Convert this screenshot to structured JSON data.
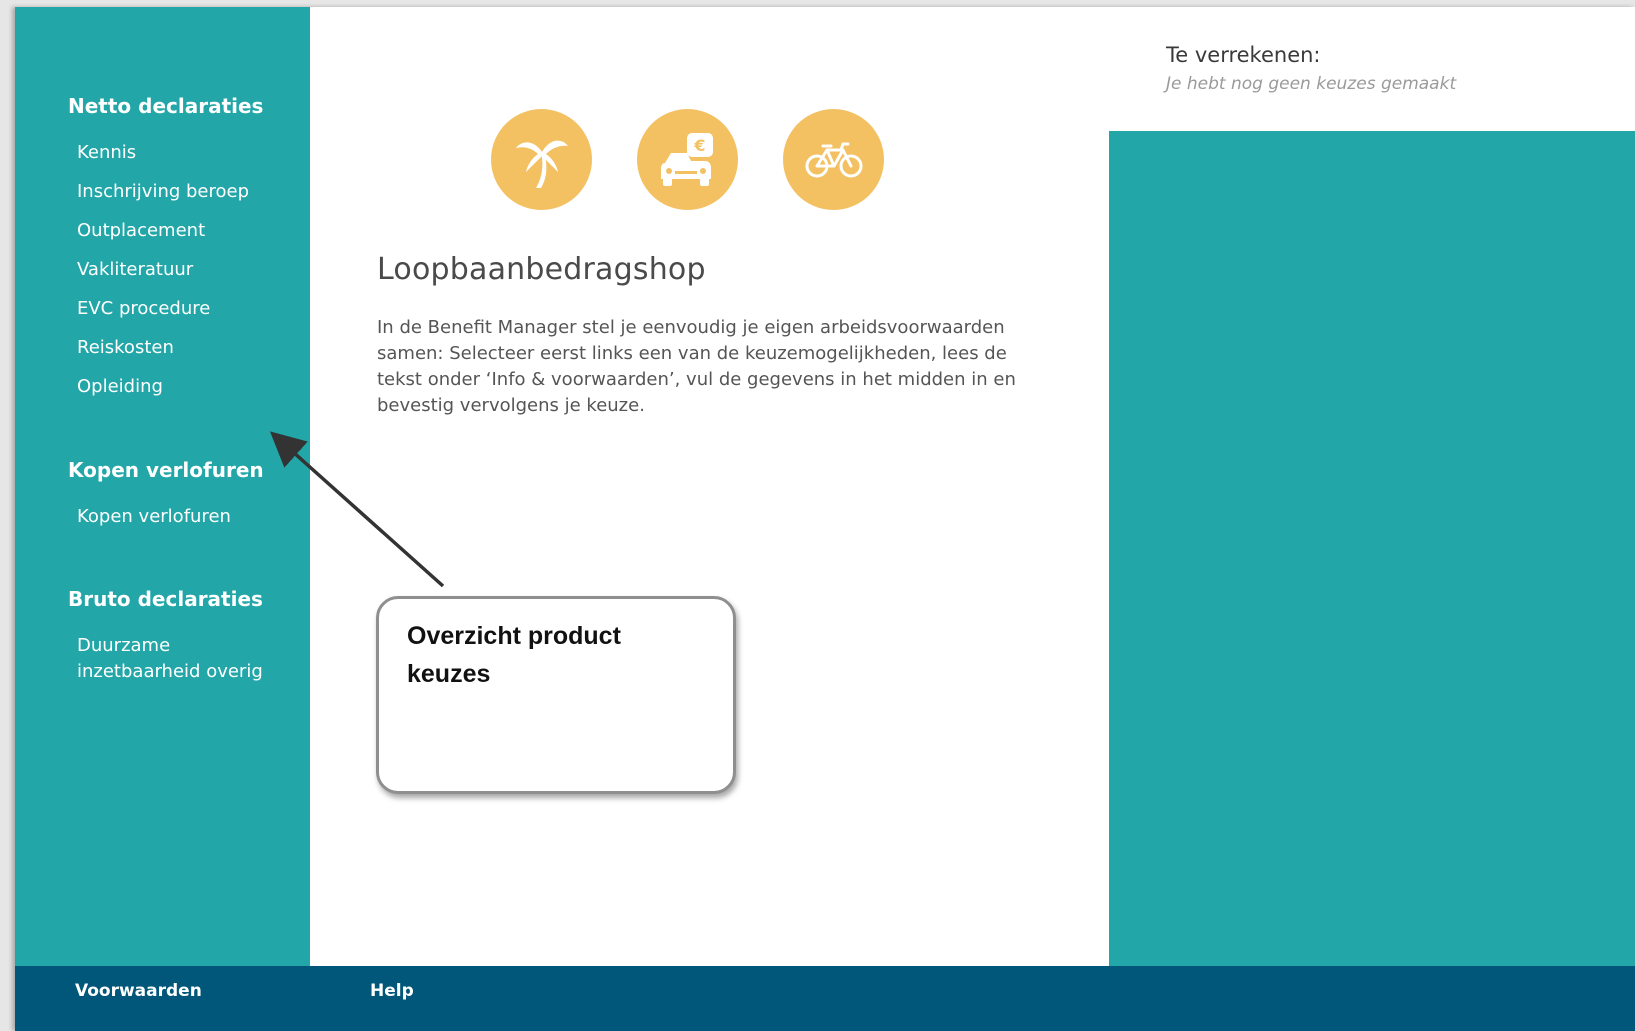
{
  "sidebar": {
    "sections": [
      {
        "title": "Netto declaraties",
        "items": [
          "Kennis",
          "Inschrijving beroep",
          "Outplacement",
          "Vakliteratuur",
          "EVC procedure",
          "Reiskosten",
          "Opleiding"
        ]
      },
      {
        "title": "Kopen verlofuren",
        "items": [
          "Kopen verlofuren"
        ]
      },
      {
        "title": "Bruto declaraties",
        "items": [
          "Duurzame inzetbaarheid overig"
        ]
      }
    ]
  },
  "main": {
    "icons": [
      "palm-tree-icon",
      "car-euro-icon",
      "bicycle-icon"
    ],
    "title": "Loopbaanbedragshop",
    "intro": "In de Benefit Manager stel je eenvoudig je eigen arbeidsvoorwaarden samen: Selecteer eerst links een van de keuzemogelijkheden, lees de tekst onder ‘Info & voorwaarden’, vul de gegevens in het midden in en bevestig vervolgens je keuze."
  },
  "summary": {
    "title": "Te verrekenen:",
    "empty_text": "Je hebt nog geen keuzes gemaakt"
  },
  "callout": {
    "text": "Overzicht product keuzes"
  },
  "footer": {
    "links": [
      "Voorwaarden",
      "Help"
    ]
  },
  "colors": {
    "teal": "#22a6a8",
    "icon_yellow": "#f3c162",
    "footer_blue": "#005779"
  }
}
